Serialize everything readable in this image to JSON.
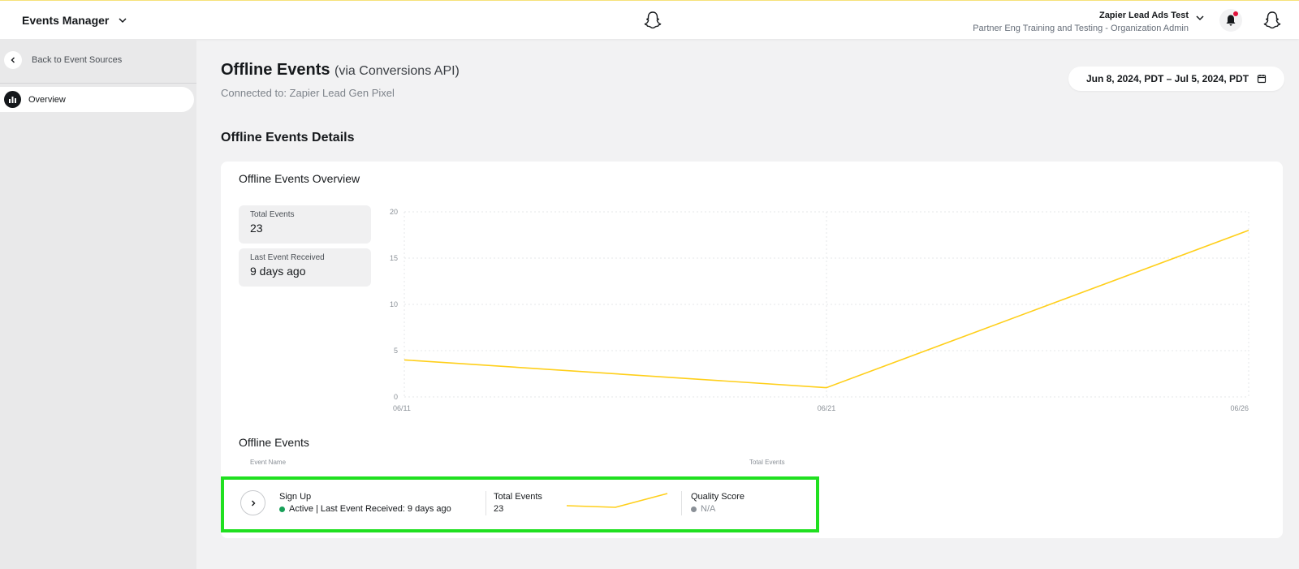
{
  "header": {
    "app_title": "Events Manager",
    "account_name": "Zapier Lead Ads Test",
    "account_role": "Partner Eng Training and Testing - Organization Admin"
  },
  "sidebar": {
    "back_label": "Back to Event Sources",
    "items": [
      {
        "label": "Overview",
        "active": true
      }
    ]
  },
  "page": {
    "title": "Offline Events",
    "title_suffix": "(via Conversions API)",
    "connected": "Connected to: Zapier Lead Gen Pixel",
    "date_range": "Jun 8, 2024, PDT – Jul 5, 2024, PDT",
    "section_title": "Offline Events Details"
  },
  "overview": {
    "title": "Offline Events Overview",
    "stats": [
      {
        "label": "Total Events",
        "value": "23"
      },
      {
        "label": "Last Event Received",
        "value": "9 days ago"
      }
    ]
  },
  "chart_data": {
    "type": "line",
    "x": [
      "06/11",
      "06/21",
      "06/26"
    ],
    "series": [
      {
        "values": [
          4,
          1,
          18
        ],
        "color": "#ffcf1a"
      }
    ],
    "y_ticks": [
      0,
      5,
      10,
      15,
      20
    ],
    "ylim": [
      0,
      20
    ],
    "grid": true
  },
  "events": {
    "title": "Offline Events",
    "col_event_name": "Event Name",
    "col_total_events": "Total Events",
    "rows": [
      {
        "name": "Sign Up",
        "status": "Active | Last Event Received: 9 days ago",
        "total_label": "Total Events",
        "total_value": "23",
        "quality_label": "Quality Score",
        "quality_value": "N/A"
      }
    ]
  },
  "colors": {
    "accent": "#ffcf1a",
    "highlight": "#20e020",
    "active": "#18a058"
  }
}
